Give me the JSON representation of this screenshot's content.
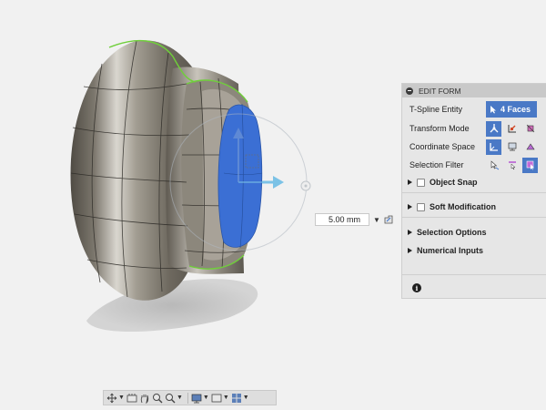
{
  "panel": {
    "title": "EDIT FORM",
    "rows": [
      {
        "label": "T-Spline Entity",
        "value": "4 Faces"
      },
      {
        "label": "Transform Mode"
      },
      {
        "label": "Coordinate Space"
      },
      {
        "label": "Selection Filter"
      }
    ],
    "sections": {
      "object_snap": "Object Snap",
      "soft_modification": "Soft Modification",
      "selection_options": "Selection Options",
      "numerical_inputs": "Numerical Inputs"
    },
    "icons": {
      "entity": "cursor-arrow-icon",
      "transform": [
        "multi-transform-icon",
        "translate-icon",
        "rotate-icon"
      ],
      "coordinate": [
        "world-space-icon",
        "view-space-icon",
        "local-space-icon"
      ],
      "filter": [
        "select-through-icon",
        "edge-filter-icon",
        "face-filter-icon"
      ]
    },
    "selected_color": "#4a79c6"
  },
  "distance": {
    "value": "5.00 mm"
  },
  "model": {
    "face_color": "#3b6fd4",
    "edge_color": "#6fcf3a",
    "body_color": "#8f8a7e"
  },
  "toolbar": {
    "icons": [
      "orbit-icon",
      "look-at-icon",
      "pan-icon",
      "zoom-icon",
      "zoom-window-icon",
      "display-mode-icon",
      "grid-icon",
      "viewports-icon"
    ]
  }
}
